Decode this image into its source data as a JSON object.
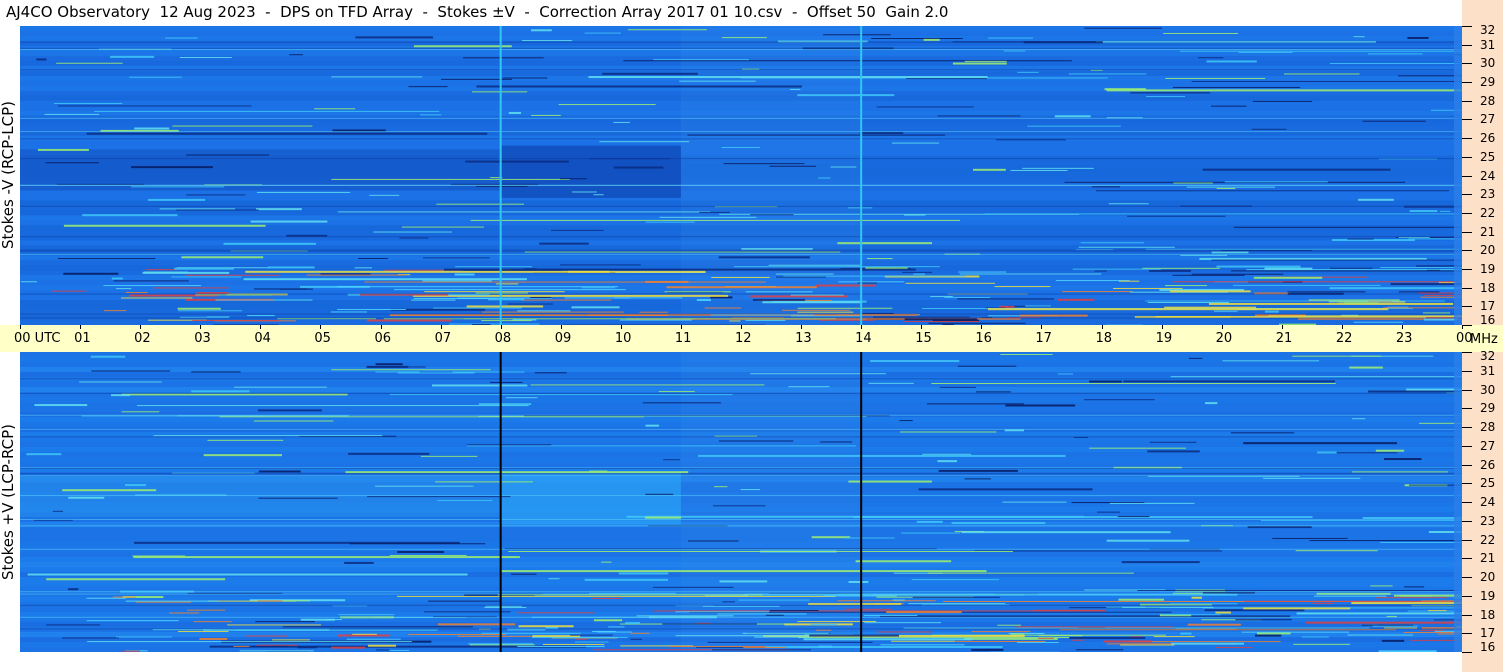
{
  "title": "AJ4CO Observatory  12 Aug 2023  -  DPS on TFD Array  -  Stokes ±V  -  Correction Array 2017 01 10.csv  -  Offset 50  Gain 2.0",
  "chart_data": [
    {
      "type": "heatmap",
      "ylabel": "Stokes -V  (RCP-LCP)",
      "x_range_utc_hours": [
        0,
        24
      ],
      "y_range_mhz": [
        16,
        32
      ],
      "colormap": "jet",
      "vertical_markers_utc": [
        8,
        14
      ],
      "marker_color": "#30c8f0"
    },
    {
      "type": "heatmap",
      "ylabel": "Stokes +V  (LCP-RCP)",
      "x_range_utc_hours": [
        0,
        24
      ],
      "y_range_mhz": [
        16,
        32
      ],
      "colormap": "jet",
      "vertical_markers_utc": [
        8,
        14
      ],
      "marker_color": "#000000"
    }
  ],
  "time_axis": {
    "labels": [
      "00  UTC",
      "01",
      "02",
      "03",
      "04",
      "05",
      "06",
      "07",
      "08",
      "09",
      "10",
      "11",
      "12",
      "13",
      "14",
      "15",
      "16",
      "17",
      "18",
      "19",
      "20",
      "21",
      "22",
      "23",
      "00"
    ],
    "unit": "MHz"
  },
  "freq_axis": {
    "labels": [
      "32",
      "31",
      "30",
      "29",
      "28",
      "27",
      "26",
      "25",
      "24",
      "23",
      "22",
      "21",
      "20",
      "19",
      "18",
      "17",
      "16"
    ]
  },
  "colors": {
    "background_strip": "#fde0c8",
    "time_axis_bg": "#ffffc8",
    "base_blue": "#1a6fe0"
  }
}
